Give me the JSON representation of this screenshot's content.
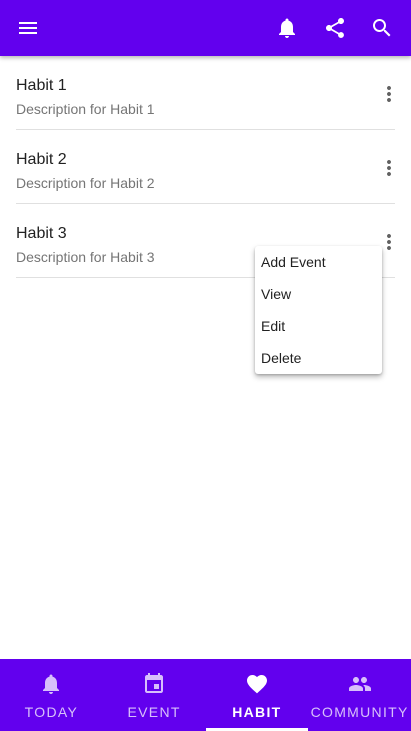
{
  "appbar": {
    "background": "#6200ee",
    "icons": [
      "menu-icon",
      "bell-icon",
      "share-icon",
      "search-icon"
    ]
  },
  "habits": [
    {
      "title": "Habit 1",
      "description": "Description for Habit 1"
    },
    {
      "title": "Habit 2",
      "description": "Description for Habit 2"
    },
    {
      "title": "Habit 3",
      "description": "Description for Habit 3"
    }
  ],
  "popup_menu": {
    "items": [
      "Add Event",
      "View",
      "Edit",
      "Delete"
    ]
  },
  "bottom_nav": {
    "items": [
      {
        "label": "TODAY",
        "icon": "bell-icon"
      },
      {
        "label": "EVENT",
        "icon": "calendar-icon"
      },
      {
        "label": "HABIT",
        "icon": "heart-icon",
        "active": true
      },
      {
        "label": "COMMUNITY",
        "icon": "people-icon"
      }
    ]
  }
}
